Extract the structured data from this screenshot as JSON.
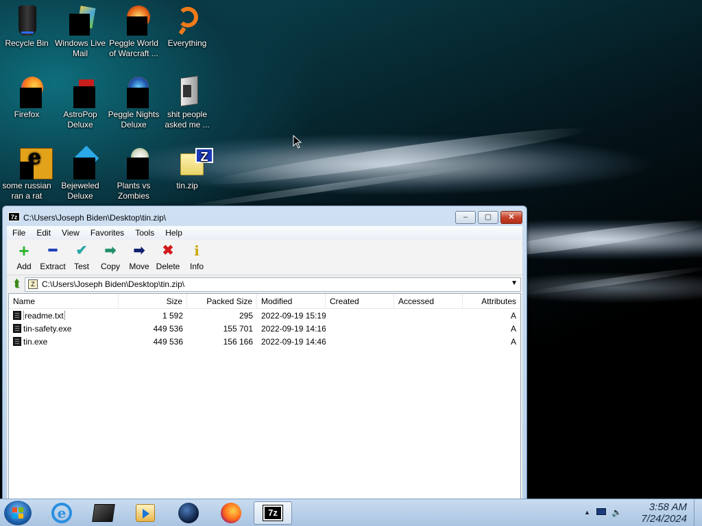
{
  "desktop": {
    "icons": [
      {
        "label": "Recycle Bin"
      },
      {
        "label": "Windows Live Mail"
      },
      {
        "label": "Peggle World of Warcraft ..."
      },
      {
        "label": "Everything"
      },
      {
        "label": "Firefox"
      },
      {
        "label": "AstroPop Deluxe"
      },
      {
        "label": "Peggle Nights Deluxe"
      },
      {
        "label": "shit people asked me ..."
      },
      {
        "label": "some russian ran a rat"
      },
      {
        "label": "Bejeweled Deluxe"
      },
      {
        "label": "Plants vs Zombies"
      },
      {
        "label": "tin.zip"
      }
    ]
  },
  "window": {
    "title": "C:\\Users\\Joseph Biden\\Desktop\\tin.zip\\",
    "app_icon": "7z",
    "controls": {
      "minimize": "–",
      "maximize": "▢",
      "close": "✕"
    },
    "menu": [
      "File",
      "Edit",
      "View",
      "Favorites",
      "Tools",
      "Help"
    ],
    "toolbar": [
      {
        "label": "Add",
        "icon": "add-plus-icon",
        "glyph": "+",
        "color": "#2bb32b"
      },
      {
        "label": "Extract",
        "icon": "extract-minus-icon",
        "glyph": "━",
        "color": "#1f3fb8"
      },
      {
        "label": "Test",
        "icon": "test-check-icon",
        "glyph": "✔",
        "color": "#2aa6a6"
      },
      {
        "label": "Copy",
        "icon": "copy-arrow-icon",
        "glyph": "➡",
        "color": "#1f8f6a"
      },
      {
        "label": "Move",
        "icon": "move-arrow-icon",
        "glyph": "➡",
        "color": "#0e1f6e"
      },
      {
        "label": "Delete",
        "icon": "delete-x-icon",
        "glyph": "✖",
        "color": "#d11a1a"
      },
      {
        "label": "Info",
        "icon": "info-icon",
        "glyph": "i",
        "color": "#c9a600"
      }
    ],
    "address": "C:\\Users\\Joseph Biden\\Desktop\\tin.zip\\",
    "columns": [
      "Name",
      "Size",
      "Packed Size",
      "Modified",
      "Created",
      "Accessed",
      "Attributes"
    ],
    "files": [
      {
        "name": "readme.txt",
        "size": "1 592",
        "packed": "295",
        "modified": "2022-09-19 15:19",
        "created": "",
        "accessed": "",
        "attr": "A"
      },
      {
        "name": "tin-safety.exe",
        "size": "449 536",
        "packed": "155 701",
        "modified": "2022-09-19 14:16",
        "created": "",
        "accessed": "",
        "attr": "A"
      },
      {
        "name": "tin.exe",
        "size": "449 536",
        "packed": "156 166",
        "modified": "2022-09-19 14:46",
        "created": "",
        "accessed": "",
        "attr": "A"
      }
    ]
  },
  "taskbar": {
    "items": [
      {
        "icon": "internet-explorer-icon"
      },
      {
        "icon": "dark-box-icon"
      },
      {
        "icon": "media-player-icon"
      },
      {
        "icon": "globe-icon"
      },
      {
        "icon": "firefox-icon"
      },
      {
        "icon": "7zip-icon",
        "label": "7z"
      }
    ],
    "clock": {
      "time": "3:58 AM",
      "date": "7/24/2024"
    }
  }
}
